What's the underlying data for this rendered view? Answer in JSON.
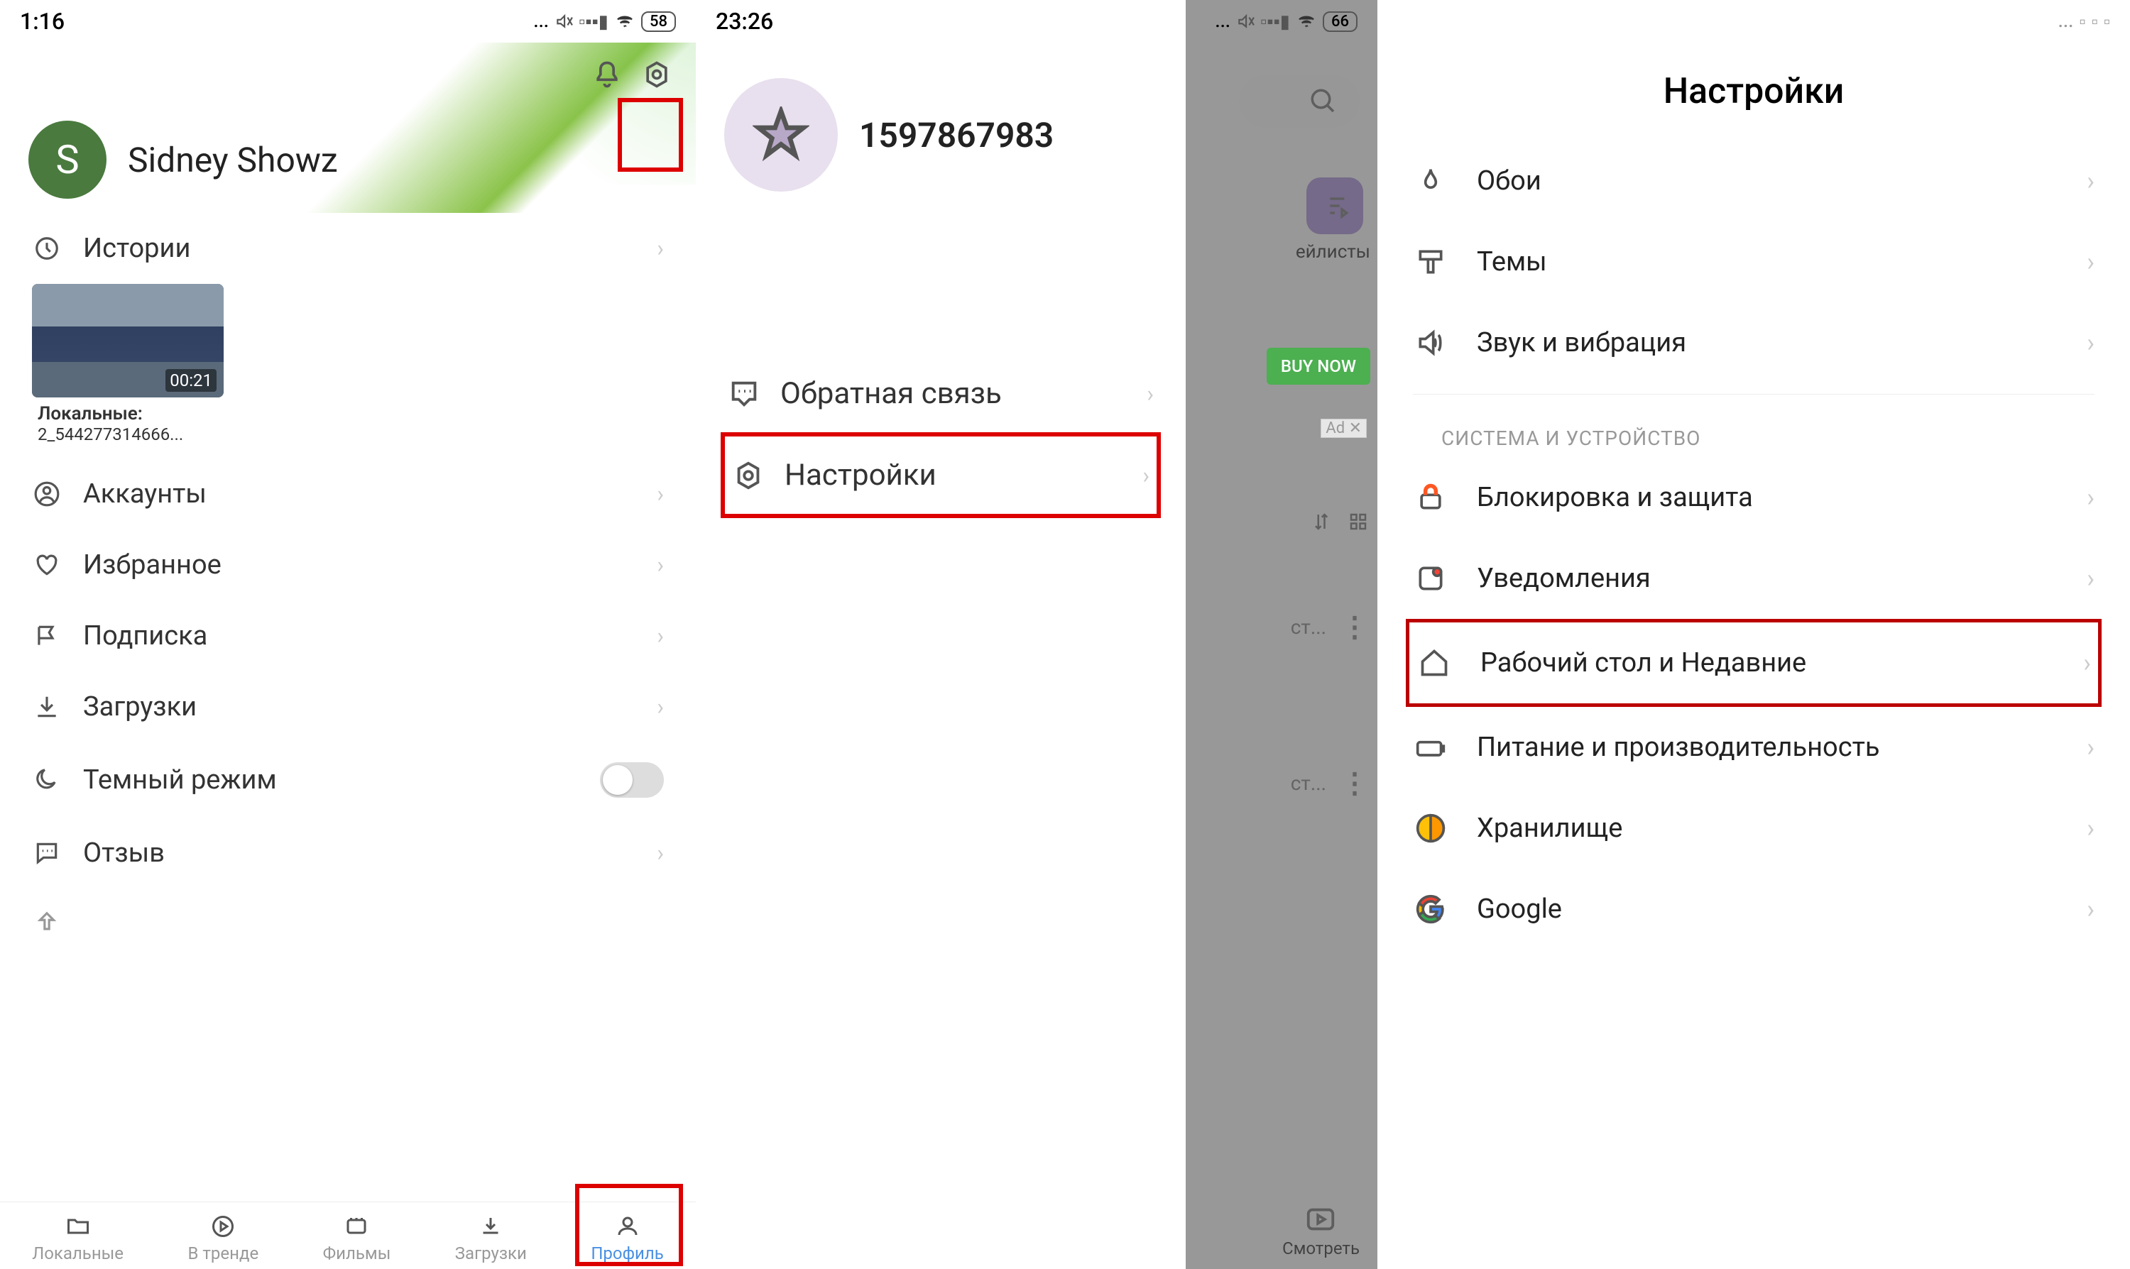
{
  "screen1": {
    "time": "1:16",
    "battery": "58",
    "profile_name": "Sidney Showz",
    "avatar_letter": "S",
    "menu": {
      "history": "Истории",
      "thumb_duration": "00:21",
      "thumb_caption_line1": "Локальные:",
      "thumb_caption_line2": "2_544277314666...",
      "accounts": "Аккаунты",
      "favorites": "Избранное",
      "subscribe": "Подписка",
      "downloads": "Загрузки",
      "dark_mode": "Темный режим",
      "feedback": "Отзыв"
    },
    "tabs": {
      "local": "Локальные",
      "trending": "В тренде",
      "movies": "Фильмы",
      "downloads": "Загрузки",
      "profile": "Профиль"
    }
  },
  "screen2": {
    "time": "23:26",
    "battery": "66",
    "user_id": "1597867983",
    "feedback": "Обратная связь",
    "settings": "Настройки",
    "bg": {
      "playlists": "ейлисты",
      "buy_now": "BUY NOW",
      "ad": "Ad",
      "item_suffix": "ст...",
      "watch": "Смотреть"
    }
  },
  "screen3": {
    "title": "Настройки",
    "items": {
      "wallpaper": "Обои",
      "themes": "Темы",
      "sound": "Звук и вибрация"
    },
    "section": "СИСТЕМА И УСТРОЙСТВО",
    "system": {
      "lock": "Блокировка и защита",
      "notifications": "Уведомления",
      "home": "Рабочий стол и Недавние",
      "battery": "Питание и производительность",
      "storage": "Хранилище",
      "google": "Google"
    }
  }
}
